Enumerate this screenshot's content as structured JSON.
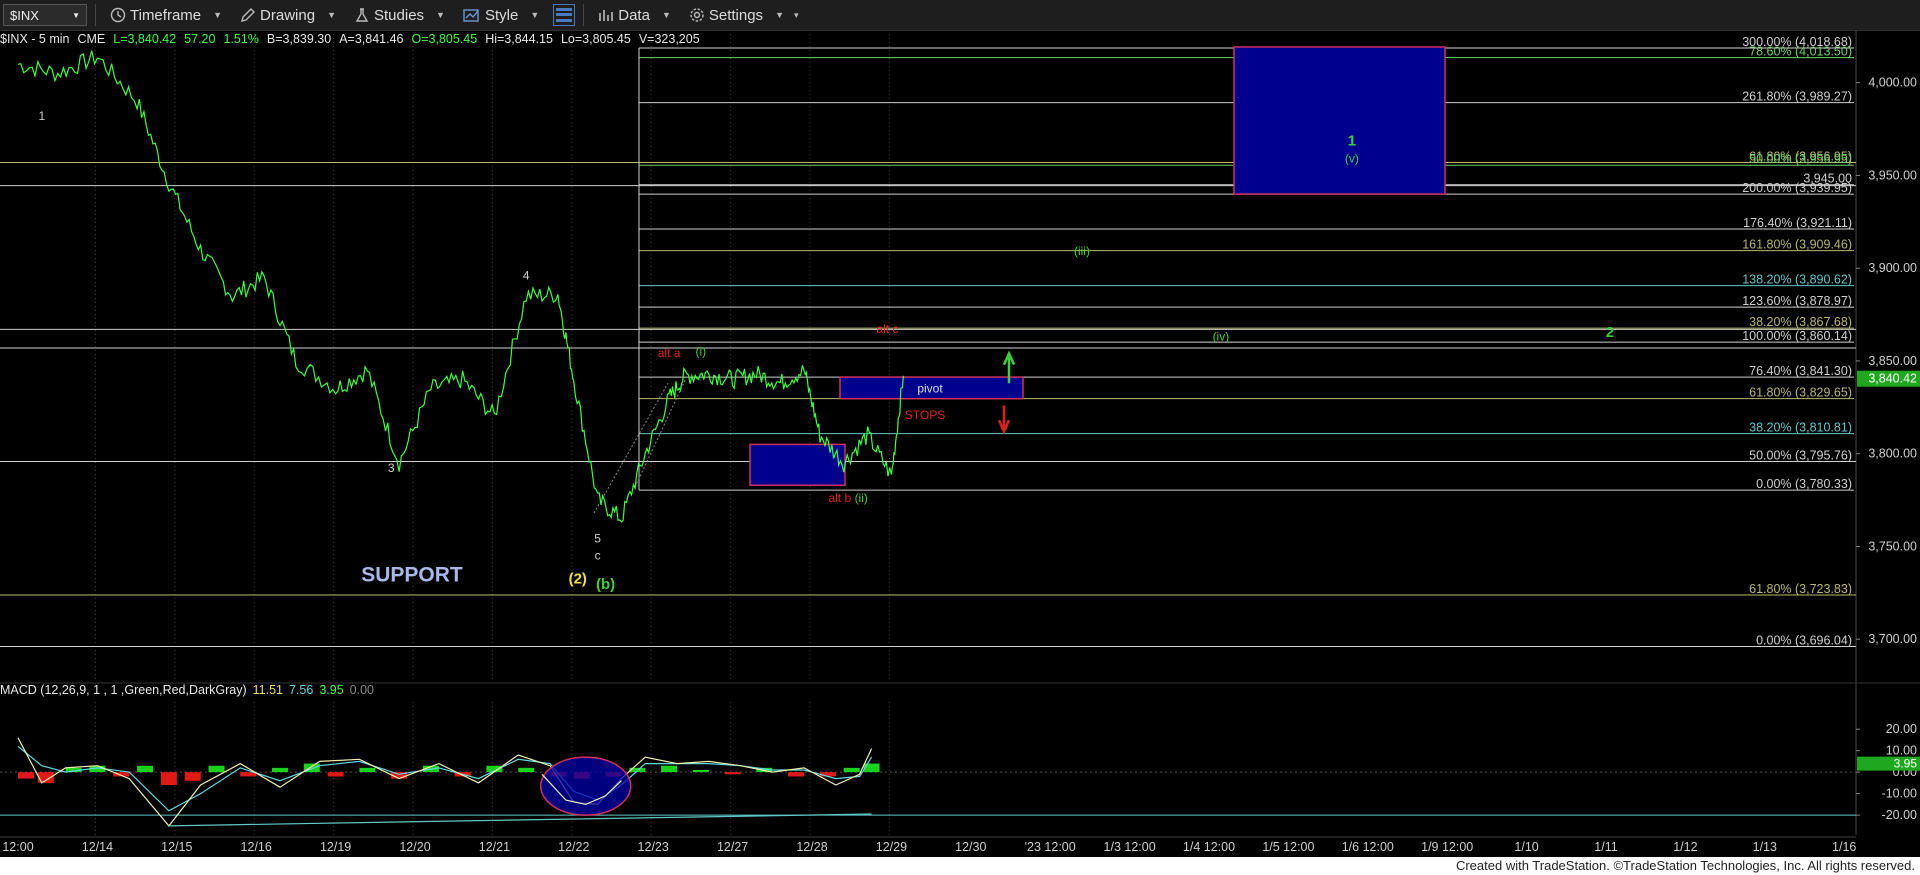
{
  "toolbar": {
    "symbol": "$INX",
    "timeframe": "Timeframe",
    "drawing": "Drawing",
    "studies": "Studies",
    "style": "Style",
    "data": "Data",
    "settings": "Settings"
  },
  "info": {
    "symbol": "$INX - 5 min",
    "exchange": "CME",
    "last": "L=3,840.42",
    "change": "57.20",
    "change_pct": "1.51%",
    "bid": "B=3,839.30",
    "ask": "A=3,841.46",
    "open": "O=3,805.45",
    "high": "Hi=3,844.15",
    "low": "Lo=3,805.45",
    "volume": "V=323,205"
  },
  "macd_legend": {
    "label": "MACD (12,26,9, 1 , 1 ,Green,Red,DarkGray)",
    "v1": "11.51",
    "v2": "7.56",
    "v3": "3.95",
    "v4": "0.00"
  },
  "footer": "Created with TradeStation. ©TradeStation Technologies, Inc. All rights reserved.",
  "colors": {
    "price": "#3cff3c",
    "fib_white": "#cfcfcf",
    "fib_olive": "#b8b86a",
    "fib_cyan": "#5fc8c8",
    "fib_green": "#6ad26a",
    "box_blue": "#00008e",
    "box_border": "#d03060",
    "red_label": "#e02020",
    "green_label": "#3cd23c",
    "yellow_label": "#f0e040",
    "support_text": "#a8b8e8",
    "last_price_bg": "#1fa81f"
  },
  "chart_data": {
    "type": "line",
    "title": "$INX - 5 min",
    "price_axis": {
      "ticks": [
        "4,000.00",
        "3,950.00",
        "3,900.00",
        "3,850.00",
        "3,800.00",
        "3,750.00",
        "3,700.00"
      ],
      "ylim": [
        3678,
        4023
      ],
      "last_price": "3,840.42"
    },
    "x_ticks": [
      "12:00",
      "12/14",
      "12/15",
      "12/16",
      "12/19",
      "12/20",
      "12/21",
      "12/22",
      "12/23",
      "12/27",
      "12/28",
      "12/29",
      "12/30",
      "'23 12:00",
      "1/3 12:00",
      "1/4 12:00",
      "1/5 12:00",
      "1/6 12:00",
      "1/9 12:00",
      "1/10",
      "1/11",
      "1/12",
      "1/13",
      "1/16"
    ],
    "price_series": {
      "name": "$INX",
      "x": [
        0,
        0.5,
        1,
        1.5,
        1.9,
        2.3,
        2.7,
        3.1,
        3.5,
        4.0,
        4.4,
        4.8,
        5.2,
        5.6,
        6.0,
        6.4,
        6.8,
        7.0,
        7.3,
        7.6,
        7.9,
        8.2,
        8.4,
        8.7,
        9.0,
        9.3,
        9.6,
        9.9,
        10.1,
        10.4,
        10.7,
        11.0,
        11.15
      ],
      "y": [
        4010,
        4005,
        4014,
        3990,
        3946,
        3910,
        3885,
        3895,
        3850,
        3835,
        3845,
        3795,
        3835,
        3840,
        3820,
        3885,
        3886,
        3840,
        3775,
        3765,
        3800,
        3830,
        3842,
        3843,
        3840,
        3843,
        3838,
        3845,
        3810,
        3795,
        3810,
        3788,
        3842
      ]
    },
    "fib_levels": [
      {
        "label": "300.00% (4,018.68)",
        "value": 4018.68,
        "color": "#cfcfcf"
      },
      {
        "label": "78.60% (4,013.50)",
        "value": 4013.5,
        "color": "#6ad26a"
      },
      {
        "label": "261.80% (3,989.27)",
        "value": 3989.27,
        "color": "#cfcfcf"
      },
      {
        "label": "61.80% (3,956.95)",
        "value": 3956.95,
        "color": "#b8b86a"
      },
      {
        "label": "50.00% (3,956.95)",
        "value": 3955.5,
        "color": "#6ad26a"
      },
      {
        "label": "3,945.00",
        "value": 3945.0,
        "color": "#cfcfcf"
      },
      {
        "label": "200.00% (3,939.95)",
        "value": 3939.95,
        "color": "#cfcfcf"
      },
      {
        "label": "176.40% (3,921.11)",
        "value": 3921.11,
        "color": "#cfcfcf"
      },
      {
        "label": "161.80% (3,909.46)",
        "value": 3909.46,
        "color": "#b8b86a"
      },
      {
        "label": "138.20% (3,890.62)",
        "value": 3890.62,
        "color": "#5fc8c8"
      },
      {
        "label": "123.60% (3,878.97)",
        "value": 3878.97,
        "color": "#cfcfcf"
      },
      {
        "label": "38.20% (3,867.68)",
        "value": 3867.68,
        "color": "#b8b86a"
      },
      {
        "label": "100.00% (3,860.14)",
        "value": 3860.14,
        "color": "#cfcfcf"
      },
      {
        "label": "76.40% (3,841.30)",
        "value": 3841.3,
        "color": "#cfcfcf"
      },
      {
        "label": "61.80% (3,829.65)",
        "value": 3829.65,
        "color": "#b8b86a"
      },
      {
        "label": "38.20% (3,810.81)",
        "value": 3810.81,
        "color": "#5fc8c8"
      },
      {
        "label": "50.00% (3,795.76)",
        "value": 3795.76,
        "color": "#cfcfcf"
      },
      {
        "label": "0.00% (3,780.33)",
        "value": 3780.33,
        "color": "#cfcfcf"
      },
      {
        "label": "61.80% (3,723.83)",
        "value": 3723.83,
        "color": "#b8b86a"
      },
      {
        "label": "0.00% (3,696.04)",
        "value": 3696.04,
        "color": "#cfcfcf"
      }
    ],
    "wave_labels": [
      {
        "text": "1",
        "x": 0.3,
        "y": 3980,
        "color": "#cfcfcf"
      },
      {
        "text": "3",
        "x": 4.7,
        "y": 3790,
        "color": "#cfcfcf"
      },
      {
        "text": "4",
        "x": 6.4,
        "y": 3894,
        "color": "#cfcfcf"
      },
      {
        "text": "5",
        "x": 7.3,
        "y": 3752,
        "color": "#cfcfcf"
      },
      {
        "text": "c",
        "x": 7.3,
        "y": 3743,
        "color": "#cfcfcf"
      },
      {
        "text": "(2)",
        "x": 7.05,
        "y": 3730,
        "color": "#f0e040"
      },
      {
        "text": "(b)",
        "x": 7.4,
        "y": 3727,
        "color": "#3cd23c"
      },
      {
        "text": "alt a",
        "x": 8.2,
        "y": 3852,
        "color": "#e02020"
      },
      {
        "text": "(i)",
        "x": 8.6,
        "y": 3853,
        "color": "#3cd23c"
      },
      {
        "text": "alt b",
        "x": 10.35,
        "y": 3774,
        "color": "#e02020"
      },
      {
        "text": "(ii)",
        "x": 10.62,
        "y": 3774,
        "color": "#3cd23c"
      },
      {
        "text": "alt c",
        "x": 10.95,
        "y": 3865,
        "color": "#e02020"
      },
      {
        "text": "(iii)",
        "x": 13.4,
        "y": 3907,
        "color": "#3cd23c"
      },
      {
        "text": "(iv)",
        "x": 15.15,
        "y": 3861,
        "color": "#3cd23c"
      },
      {
        "text": "1",
        "x": 16.8,
        "y": 3966,
        "color": "#3cd23c"
      },
      {
        "text": "(v)",
        "x": 16.8,
        "y": 3957,
        "color": "#3cd23c"
      },
      {
        "text": "2",
        "x": 20.05,
        "y": 3863,
        "color": "#3cd23c"
      }
    ],
    "annotations": {
      "support": "SUPPORT",
      "pivot": "pivot",
      "stops": "STOPS"
    },
    "macd": {
      "ticks": [
        "20.00",
        "10.00",
        "0.00",
        "-10.00",
        "-20.00"
      ],
      "ylim": [
        -26,
        28
      ],
      "last_histogram": "3.95",
      "macd_line": {
        "x": [
          0,
          0.3,
          0.6,
          1.0,
          1.4,
          1.9,
          2.3,
          2.8,
          3.3,
          3.8,
          4.3,
          4.8,
          5.3,
          5.8,
          6.3,
          6.7,
          7.0,
          7.3,
          7.6,
          7.9,
          8.3,
          8.7,
          9.1,
          9.5,
          9.9,
          10.3,
          10.6,
          10.75
        ],
        "y": [
          16,
          -5,
          2,
          3,
          -3,
          -25,
          -6,
          4,
          -7,
          5,
          6,
          -3,
          4,
          -5,
          8,
          3,
          -14,
          -15,
          -3,
          7,
          4,
          5,
          3,
          0,
          2,
          -6,
          -1,
          11
        ]
      },
      "signal_line": {
        "x": [
          0,
          0.3,
          0.6,
          1.0,
          1.4,
          1.9,
          2.3,
          2.8,
          3.3,
          3.8,
          4.3,
          4.8,
          5.3,
          5.8,
          6.3,
          6.7,
          7.0,
          7.3,
          7.6,
          7.9,
          8.3,
          8.7,
          9.1,
          9.5,
          9.9,
          10.3,
          10.6,
          10.75
        ],
        "y": [
          12,
          3,
          0,
          2,
          0,
          -18,
          -10,
          2,
          -4,
          3,
          5,
          -1,
          2,
          -3,
          6,
          4,
          -9,
          -13,
          -6,
          4,
          4,
          4,
          3,
          1,
          1,
          -3,
          -2,
          7
        ]
      },
      "histogram": {
        "x": [
          0.1,
          0.35,
          0.7,
          1.0,
          1.3,
          1.6,
          1.9,
          2.2,
          2.5,
          2.9,
          3.3,
          3.7,
          4.0,
          4.4,
          4.8,
          5.2,
          5.6,
          6.0,
          6.4,
          6.8,
          7.1,
          7.5,
          7.8,
          8.2,
          8.6,
          9.0,
          9.4,
          9.8,
          10.2,
          10.5,
          10.75
        ],
        "y": [
          -3,
          -5,
          2,
          3,
          -2,
          3,
          -6,
          -4,
          3,
          -2,
          2,
          4,
          -2,
          2,
          -3,
          3,
          -2,
          3,
          2,
          -2,
          -3,
          -2,
          2,
          3,
          1,
          -1,
          2,
          -2,
          -2,
          2,
          4
        ]
      },
      "trendline": {
        "x": [
          1.9,
          10.75
        ],
        "y": [
          -25,
          -19.5
        ]
      },
      "circle_center": {
        "x": 7.15,
        "y": -6.5
      }
    }
  }
}
